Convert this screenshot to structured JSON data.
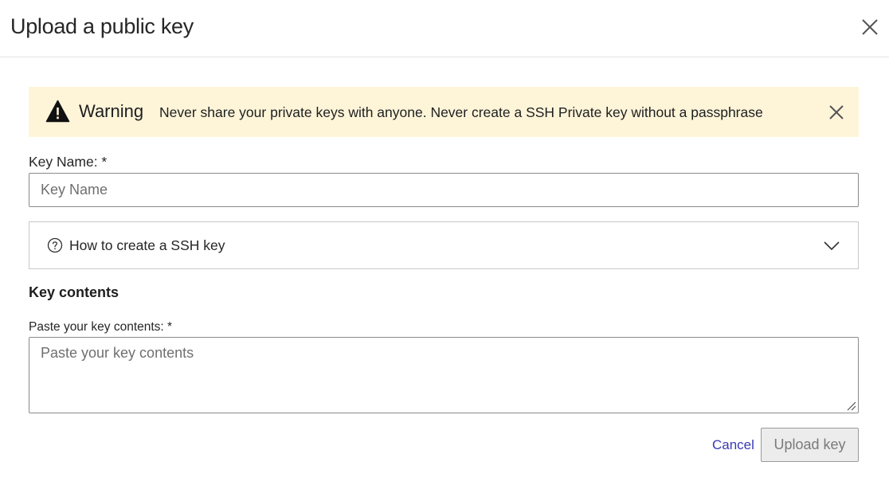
{
  "dialog": {
    "title": "Upload a public key",
    "close_icon": "close-icon"
  },
  "warning": {
    "icon": "warning-triangle-icon",
    "title": "Warning",
    "message": "Never share your private keys with anyone. Never create a SSH Private key without a passphrase",
    "background": "#fef5d9",
    "dismiss_icon": "close-icon"
  },
  "key_name": {
    "label": "Key Name: *",
    "value": "",
    "placeholder": "Key Name"
  },
  "ssh_help": {
    "icon": "help-circle-icon",
    "label": "How to create a SSH key",
    "expanded": false,
    "toggle_icon": "chevron-down-icon"
  },
  "key_contents": {
    "heading": "Key contents",
    "label": "Paste your key contents: *",
    "value": "",
    "placeholder": "Paste your key contents"
  },
  "actions": {
    "cancel_label": "Cancel",
    "upload_label": "Upload key",
    "upload_disabled": true,
    "link_color": "#3a3ab5"
  }
}
